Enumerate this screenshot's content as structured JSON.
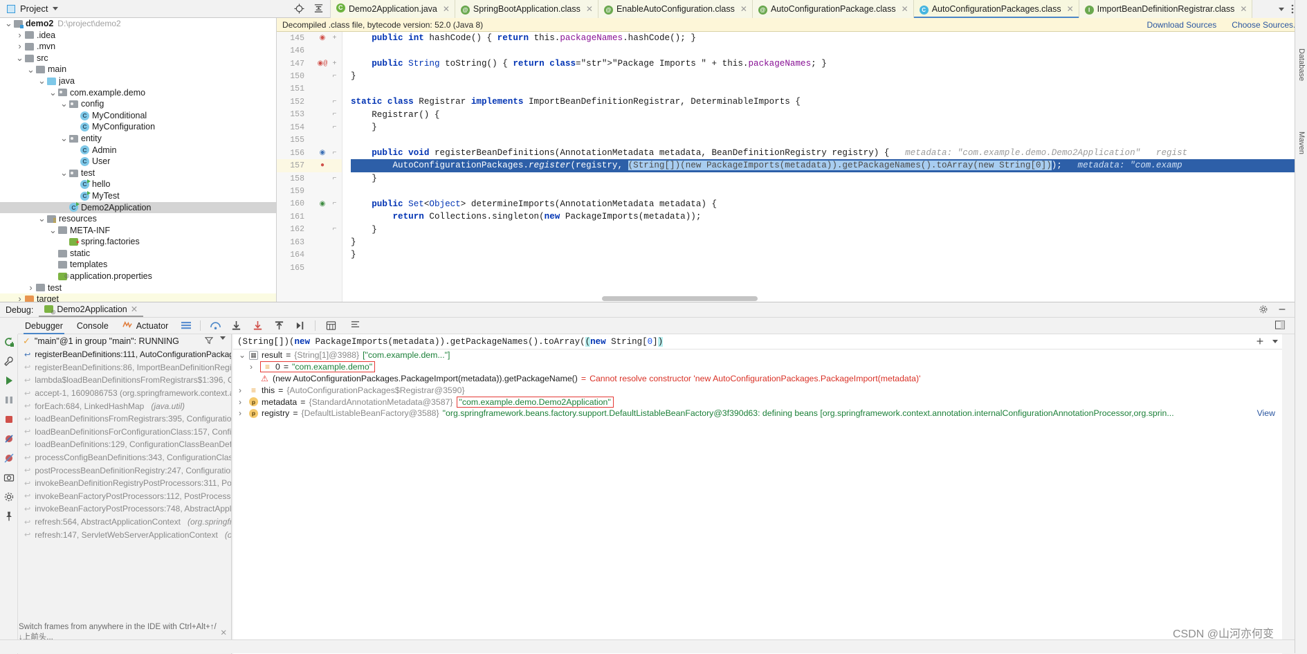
{
  "toolwindow": {
    "title": "Project",
    "icons": [
      "locate-icon",
      "collapse-all-icon",
      "settings-icon",
      "hide-icon"
    ]
  },
  "tree": [
    {
      "indent": 0,
      "arrow": "v",
      "icon": "module-folder",
      "label": "demo2",
      "bold": true,
      "path": "D:\\project\\demo2"
    },
    {
      "indent": 1,
      "arrow": ">",
      "icon": "folder",
      "label": ".idea"
    },
    {
      "indent": 1,
      "arrow": ">",
      "icon": "folder",
      "label": ".mvn"
    },
    {
      "indent": 1,
      "arrow": "v",
      "icon": "folder",
      "label": "src"
    },
    {
      "indent": 2,
      "arrow": "v",
      "icon": "folder",
      "label": "main"
    },
    {
      "indent": 3,
      "arrow": "v",
      "icon": "folder-source",
      "label": "java"
    },
    {
      "indent": 4,
      "arrow": "v",
      "icon": "package",
      "label": "com.example.demo"
    },
    {
      "indent": 5,
      "arrow": "v",
      "icon": "package",
      "label": "config"
    },
    {
      "indent": 6,
      "arrow": "",
      "icon": "class",
      "label": "MyConditional"
    },
    {
      "indent": 6,
      "arrow": "",
      "icon": "class",
      "label": "MyConfiguration"
    },
    {
      "indent": 5,
      "arrow": "v",
      "icon": "package",
      "label": "entity"
    },
    {
      "indent": 6,
      "arrow": "",
      "icon": "class",
      "label": "Admin"
    },
    {
      "indent": 6,
      "arrow": "",
      "icon": "class",
      "label": "User"
    },
    {
      "indent": 5,
      "arrow": "v",
      "icon": "package",
      "label": "test"
    },
    {
      "indent": 6,
      "arrow": "",
      "icon": "class-runnable",
      "label": "hello"
    },
    {
      "indent": 6,
      "arrow": "",
      "icon": "class-runnable",
      "label": "MyTest"
    },
    {
      "indent": 5,
      "arrow": "",
      "icon": "class-runnable",
      "label": "Demo2Application",
      "selected": true
    },
    {
      "indent": 3,
      "arrow": "v",
      "icon": "folder-resources",
      "label": "resources"
    },
    {
      "indent": 4,
      "arrow": "v",
      "icon": "folder",
      "label": "META-INF"
    },
    {
      "indent": 5,
      "arrow": "",
      "icon": "spring-file",
      "label": "spring.factories"
    },
    {
      "indent": 4,
      "arrow": "",
      "icon": "folder",
      "label": "static"
    },
    {
      "indent": 4,
      "arrow": "",
      "icon": "folder",
      "label": "templates"
    },
    {
      "indent": 4,
      "arrow": "",
      "icon": "properties-file",
      "label": "application.properties"
    },
    {
      "indent": 2,
      "arrow": ">",
      "icon": "folder",
      "label": "test"
    },
    {
      "indent": 1,
      "arrow": ">",
      "icon": "folder-target",
      "label": "target",
      "highlight": true
    }
  ],
  "tabs": [
    {
      "label": "Demo2Application.java",
      "icon": "spring-class-icon",
      "active": false
    },
    {
      "label": "SpringBootApplication.class",
      "icon": "annotation-icon",
      "active": false
    },
    {
      "label": "EnableAutoConfiguration.class",
      "icon": "annotation-icon",
      "active": false
    },
    {
      "label": "AutoConfigurationPackage.class",
      "icon": "annotation-icon",
      "active": false
    },
    {
      "label": "AutoConfigurationPackages.class",
      "icon": "class-icon",
      "active": true
    },
    {
      "label": "ImportBeanDefinitionRegistrar.class",
      "icon": "interface-icon",
      "active": false
    }
  ],
  "editor": {
    "banner_text": "Decompiled .class file, bytecode version: 52.0 (Java 8)",
    "download_sources": "Download Sources",
    "choose_sources": "Choose Sources...",
    "line_numbers": [
      "145",
      "146",
      "147",
      "150",
      "151",
      "152",
      "153",
      "154",
      "155",
      "156",
      "157",
      "158",
      "159",
      "160",
      "161",
      "162",
      "163",
      "164",
      "165"
    ],
    "lines": [
      "    public int hashCode() { return this.packageNames.hashCode(); }",
      "",
      "    public String toString() { return \"Package Imports \" + this.packageNames; }",
      "}",
      "",
      "static class Registrar implements ImportBeanDefinitionRegistrar, DeterminableImports {",
      "    Registrar() {",
      "    }",
      "",
      "    public void registerBeanDefinitions(AnnotationMetadata metadata, BeanDefinitionRegistry registry) {",
      "        AutoConfigurationPackages.register(registry, (String[])(new PackageImports(metadata)).getPackageNames().toArray(new String[0]));",
      "    }",
      "",
      "    public Set<Object> determineImports(AnnotationMetadata metadata) {",
      "        return Collections.singleton(new PackageImports(metadata));",
      "    }",
      "}",
      "}",
      ""
    ],
    "inline_hint_metadata": "metadata: \"com.example.demo.Demo2Application\"",
    "inline_hint_registry": "regist",
    "inline_hint_metadata2": "metadata: \"com.examp"
  },
  "debug": {
    "label": "Debug:",
    "config_name": "Demo2Application",
    "tabs": [
      "Debugger",
      "Console",
      "Actuator"
    ],
    "active_tab": "Debugger",
    "thread_status": "\"main\"@1 in group \"main\": RUNNING",
    "frames": [
      {
        "text": "registerBeanDefinitions:111, AutoConfigurationPackages$R",
        "first": true
      },
      {
        "text": "registerBeanDefinitions:86, ImportBeanDefinitionRegistrar"
      },
      {
        "text": "lambda$loadBeanDefinitionsFromRegistrars$1:396, Configu"
      },
      {
        "text": "accept-1, 1609086753 (org.springframework.context.annot"
      },
      {
        "text": "forEach:684, LinkedHashMap",
        "italic": "(java.util)"
      },
      {
        "text": "loadBeanDefinitionsFromRegistrars:395, ConfigurationClas"
      },
      {
        "text": "loadBeanDefinitionsForConfigurationClass:157, Configurati"
      },
      {
        "text": "loadBeanDefinitions:129, ConfigurationClassBeanDefinition"
      },
      {
        "text": "processConfigBeanDefinitions:343, ConfigurationClassPostl"
      },
      {
        "text": "postProcessBeanDefinitionRegistry:247, ConfigurationClass"
      },
      {
        "text": "invokeBeanDefinitionRegistryPostProcessors:311, PostProc"
      },
      {
        "text": "invokeBeanFactoryPostProcessors:112, PostProcessorRegis"
      },
      {
        "text": "invokeBeanFactoryPostProcessors:748, AbstractApplication"
      },
      {
        "text": "refresh:564, AbstractApplicationContext",
        "italic": "(org.springframew"
      },
      {
        "text": "refresh:147, ServletWebServerApplicationContext",
        "italic": "(org.sprin"
      }
    ],
    "frames_hint": "Switch frames from anywhere in the IDE with Ctrl+Alt+↑/↓上前头...",
    "expression": "(String[])(new PackageImports(metadata)).getPackageNames().toArray(new String[0])",
    "variables": [
      {
        "arrow": "v",
        "icon": "array-icon",
        "name": "result",
        "meta": "{String[1]@3988}",
        "value": "[\"com.example.dem...\"]",
        "indent": 0
      },
      {
        "arrow": ">",
        "icon": "string-icon",
        "name": "0",
        "meta": "",
        "value": "\"com.example.demo\"",
        "indent": 1,
        "boxed": true
      },
      {
        "arrow": "",
        "icon": "error-icon",
        "name": "(new AutoConfigurationPackages.PackageImport(metadata)).getPackageName()",
        "meta": "",
        "value": "Cannot resolve constructor 'new AutoConfigurationPackages.PackageImport(metadata)'",
        "indent": 1,
        "error": true
      },
      {
        "arrow": ">",
        "icon": "string-icon",
        "name": "this",
        "meta": "{AutoConfigurationPackages$Registrar@3590}",
        "value": "",
        "indent": 0
      },
      {
        "arrow": ">",
        "icon": "param-icon",
        "name": "metadata",
        "meta": "{StandardAnnotationMetadata@3587}",
        "value": "\"com.example.demo.Demo2Application\"",
        "indent": 0,
        "boxed_value": true
      },
      {
        "arrow": ">",
        "icon": "param-icon",
        "name": "registry",
        "meta": "{DefaultListableBeanFactory@3588}",
        "value": "\"org.springframework.beans.factory.support.DefaultListableBeanFactory@3f390d63: defining beans [org.springframework.context.annotation.internalConfigurationAnnotationProcessor,org.sprin...",
        "indent": 0,
        "link": "View"
      }
    ]
  },
  "statusbar": {
    "text": ""
  },
  "watermark": "CSDN @山河亦何变",
  "right_strip": [
    "Database",
    "Maven",
    "m"
  ],
  "colors": {
    "tab_bg": "#f7f7e7",
    "accent_blue": "#4a86c8",
    "exec_line": "#2d5fa8",
    "selection": "#a8cdf0",
    "error_red": "#d93025",
    "string_green": "#1a7f37",
    "keyword_blue": "#0033b3",
    "field_purple": "#871094"
  }
}
